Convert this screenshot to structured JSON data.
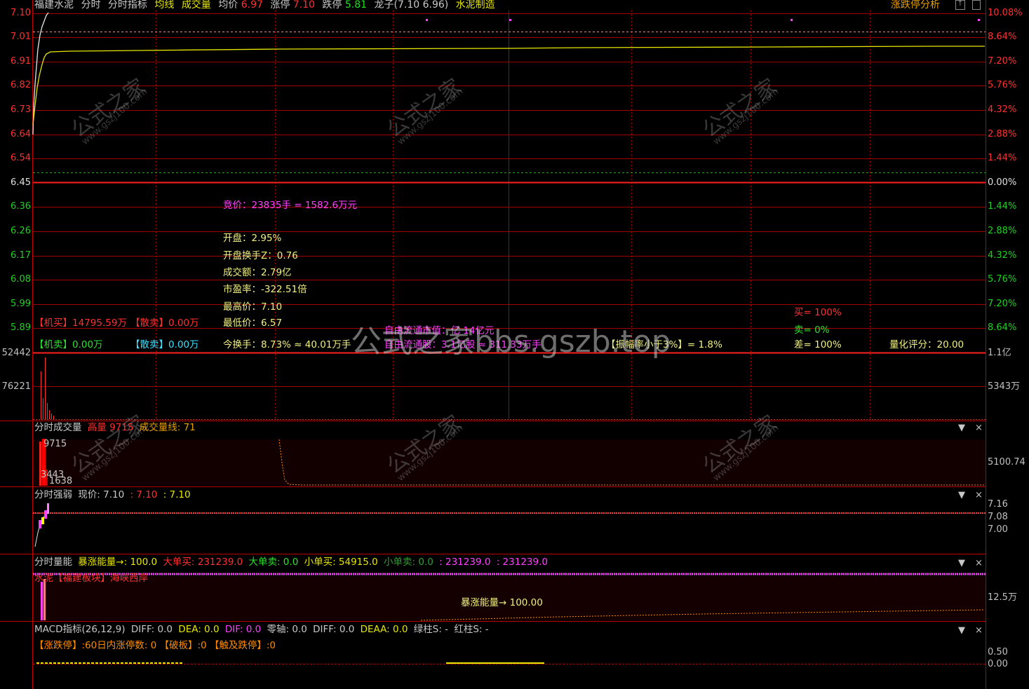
{
  "header": {
    "stock": "福建水泥",
    "view": "分时",
    "indicator": "分时指标",
    "avgline": "均线",
    "volume": "成交量",
    "avg_label": "均价",
    "avg_val": "6.97",
    "limitup_label": "涨停",
    "limitup_val": "7.10",
    "limitdown_label": "跌停",
    "limitdown_val": "5.81",
    "dragon": "龙子(7.10 6.96)",
    "sector": "水泥制造",
    "right_title": "涨跌停分析"
  },
  "axis": {
    "left_prices": [
      "7.10",
      "7.01",
      "6.91",
      "6.82",
      "6.73",
      "6.64",
      "6.54",
      "6.45",
      "6.36",
      "6.26",
      "6.17",
      "6.08",
      "5.99",
      "5.89"
    ],
    "right_pcts": [
      "10.08%",
      "8.64%",
      "7.20%",
      "5.76%",
      "4.32%",
      "2.88%",
      "1.44%",
      "0.00%",
      "1.44%",
      "2.88%",
      "4.32%",
      "5.76%",
      "7.20%",
      "8.64%"
    ],
    "vol_left": [
      "52442",
      "76221"
    ],
    "vol_right": [
      "1.1亿",
      "5343万"
    ]
  },
  "info": {
    "auction": "竞价：23835手 = 1582.6万元",
    "open": "开盘：2.95%",
    "open_turnover": "开盘换手Z：0.76",
    "amount": "成交额：2.79亿",
    "pe": "市盈率：-322.51倍",
    "high": "最高价：7.10",
    "low": "最低价：6.57",
    "turnover": "今换手：8.73% ≈ 40.01万手",
    "inst_buy": "【机买】14795.59万",
    "retail_buy": "【散卖】0.00万",
    "inst_sell": "【机卖】0.00万",
    "retail_sell": "【散卖】0.00万",
    "float_cap": "自由流通市值：亿 14亿元",
    "float_shares": "自由流通股：3.1亿股 ≈ 311.33万手",
    "rate": "【振幅率小于3%】= 1.8%",
    "buy_pct": "买= 100%",
    "sell_pct": "卖= 0%",
    "diff_pct": "差= 100%",
    "score": "量化评分：20.00"
  },
  "watermark": {
    "text": "公式之家bbs.gszb.top",
    "logo": "公式之家",
    "url": "www.gszj100.com"
  },
  "panel_volume": {
    "title": "分时成交量",
    "high_label": "高量",
    "high_val": "9715",
    "line_label": "成交量线: 71",
    "v1": "9715",
    "v2": "3443",
    "v3": "1638",
    "right_val": "5100.74"
  },
  "panel_strength": {
    "title": "分时强弱",
    "price": "现价: 7.10",
    "v1": ": 7.10",
    "v2": ": 7.10",
    "r1": "7.16",
    "r2": "7.08",
    "r3": "7.00"
  },
  "panel_energy": {
    "title": "分时量能",
    "surge": "暴涨能量→: 100.0",
    "big_buy": "大单买: 231239.0",
    "big_sell": "大单卖: 0.0",
    "small_buy": "小单买: 54915.0",
    "small_sell": "小单卖: 0.0",
    "v1": ": 231239.0",
    "v2": ": 231239.0",
    "sector_line": "水泥【福建板块】海峡西岸",
    "center": "暴涨能量→ 100.00",
    "right_val": "12.5万"
  },
  "panel_macd": {
    "title": "MACD指标(26,12,9)",
    "diff": "DIFF: 0.0",
    "dea": "DEA: 0.0",
    "dif": "DIF: 0.0",
    "zero": "零轴: 0.0",
    "diff2": "DIFF: 0.0",
    "deaa": "DEAA: 0.0",
    "green": "绿柱S: -",
    "red": "红柱S: -",
    "limit_line": "【涨跌停】:60日内涨停数: 0 【破板】:0 【触及跌停】:0",
    "r1": "0.50",
    "r2": "0.00"
  },
  "controls": {
    "down": "▼",
    "close": "×"
  }
}
